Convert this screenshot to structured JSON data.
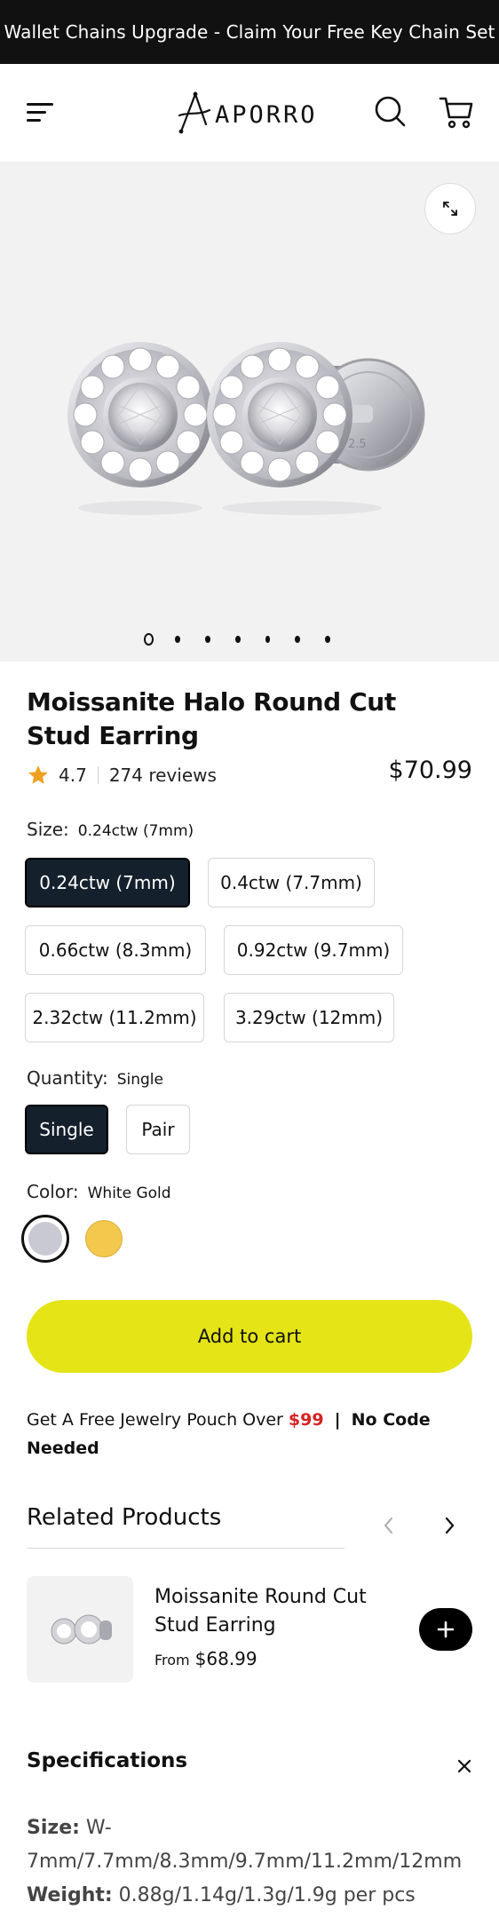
{
  "announcement": "Wallet Chains Upgrade - Claim Your Free Key Chain Set",
  "header": {
    "logo_text": "APORRO",
    "menu_icon": "hamburger-menu-icon",
    "search_icon": "search-icon",
    "cart_icon": "cart-icon"
  },
  "gallery": {
    "expand_icon": "expand-icon",
    "slide_count": 7,
    "active_slide": 1
  },
  "product": {
    "title": "Moissanite Halo Round Cut Stud Earring",
    "rating": "4.7",
    "reviews": "274 reviews",
    "price": "$70.99"
  },
  "size": {
    "label": "Size:",
    "selected": "0.24ctw (7mm)",
    "options": [
      "0.24ctw (7mm)",
      "0.4ctw (7.7mm)",
      "0.66ctw (8.3mm)",
      "0.92ctw (9.7mm)",
      "2.32ctw (11.2mm)",
      "3.29ctw (12mm)"
    ]
  },
  "quantity": {
    "label": "Quantity:",
    "selected": "Single",
    "options": [
      "Single",
      "Pair"
    ]
  },
  "color": {
    "label": "Color:",
    "selected": "White Gold",
    "swatches": [
      {
        "name": "White Gold",
        "hex": "#c9c9d3"
      },
      {
        "name": "Yellow Gold",
        "hex": "#f2c94c"
      }
    ]
  },
  "add_to_cart": "Add to cart",
  "promo": {
    "text": "Get A Free Jewelry Pouch Over",
    "amount": "$99",
    "divider": "|",
    "strong": "No Code Needed"
  },
  "related": {
    "title": "Related Products",
    "items": [
      {
        "name": "Moissanite Round Cut Stud Earring",
        "from": "From",
        "price": "$68.99"
      }
    ]
  },
  "specifications": {
    "title": "Specifications",
    "size_key": "Size:",
    "size_value": "W-7mm/7.7mm/8.3mm/9.7mm/11.2mm/12mm",
    "weight_key": "Weight:",
    "weight_value": "0.88g/1.14g/1.3g/1.9g per pcs"
  },
  "colors": {
    "accent": "#e4e417",
    "selected_chip": "#14202c",
    "price_highlight": "#d42424"
  }
}
